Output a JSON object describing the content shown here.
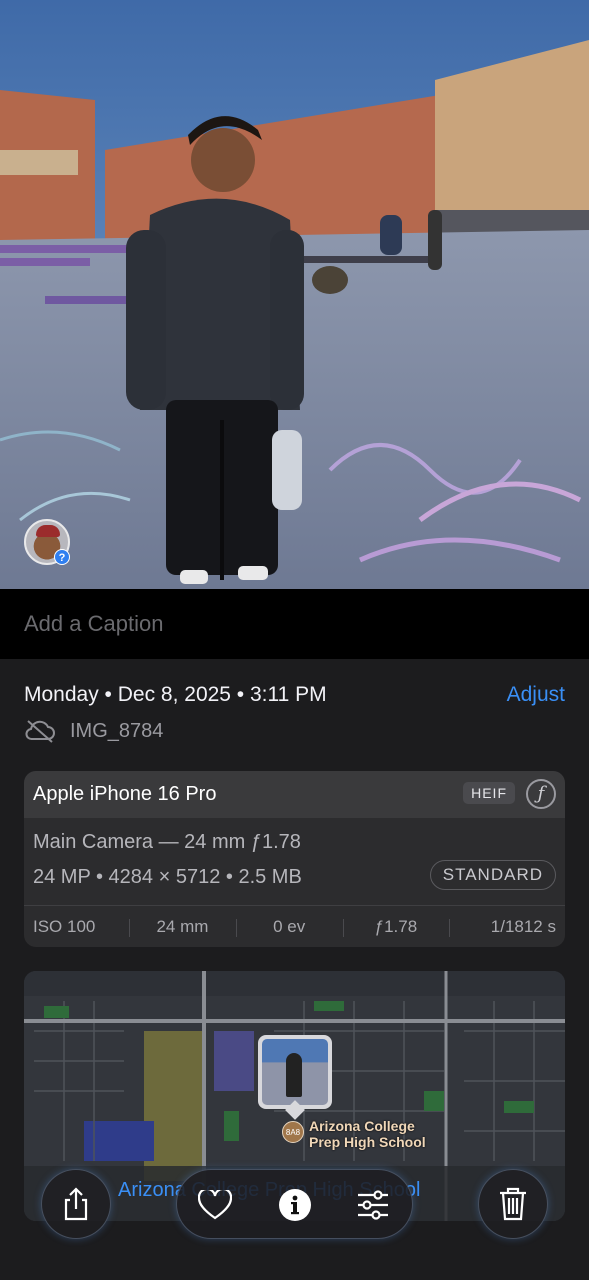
{
  "photo": {
    "face_badge": "person-with-question-badge",
    "badge_symbol": "?"
  },
  "caption": {
    "placeholder": "Add a Caption"
  },
  "meta": {
    "date_line": "Monday • Dec 8, 2025 • 3:11 PM",
    "adjust_label": "Adjust",
    "filename": "IMG_8784",
    "cloud_icon": "cloud-slash-icon"
  },
  "camera": {
    "device": "Apple iPhone 16 Pro",
    "format_badge": "HEIF",
    "aperture_button": "ƒ",
    "lens": "Main Camera — 24 mm ƒ1.78",
    "specs": "24 MP • 4284 × 5712 • 2.5 MB",
    "style_badge": "STANDARD",
    "exif": [
      "ISO 100",
      "24 mm",
      "0 ev",
      "ƒ1.78",
      "1/1812 s"
    ]
  },
  "map": {
    "place_label_line1": "Arizona College",
    "place_label_line2": "Prep High School",
    "pin_text": "8A8",
    "footer_text": "Arizona College Prep High School"
  },
  "toolbar": {
    "share": "share-icon",
    "favorite": "heart-icon",
    "info": "info-icon",
    "edit": "sliders-icon",
    "delete": "trash-icon"
  },
  "colors": {
    "accent": "#3a8ff5",
    "background": "#1c1c1e"
  }
}
